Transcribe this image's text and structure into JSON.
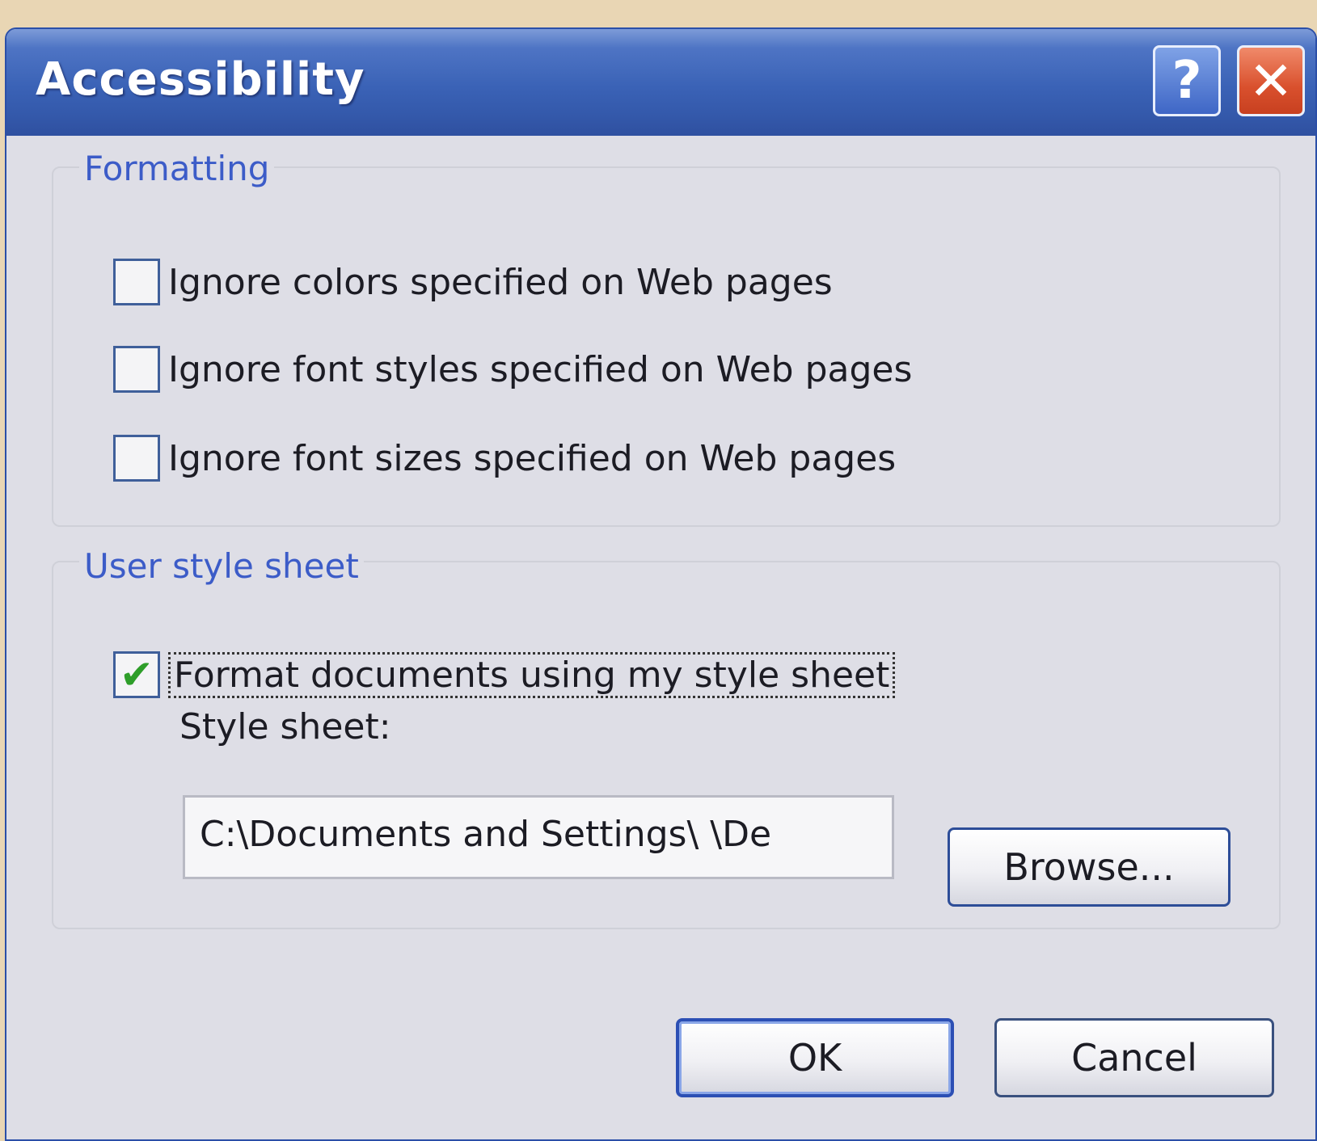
{
  "window": {
    "title": "Accessibility",
    "help_label": "?",
    "close_label": "✕"
  },
  "formatting": {
    "group_label": "Formatting",
    "options": [
      {
        "label": "Ignore colors specified on Web pages",
        "checked": false
      },
      {
        "label": "Ignore font styles specified on Web pages",
        "checked": false
      },
      {
        "label": "Ignore font sizes specified on Web pages",
        "checked": false
      }
    ]
  },
  "user_style_sheet": {
    "group_label": "User style sheet",
    "format_option": {
      "label": "Format documents using my style sheet",
      "checked": true,
      "check_mark": "✔"
    },
    "field_label": "Style sheet:",
    "path_value": "C:\\Documents and Settings\\ \\De",
    "browse_label": "Browse..."
  },
  "buttons": {
    "ok_label": "OK",
    "cancel_label": "Cancel"
  },
  "colors": {
    "titlebar": "#3a62b6",
    "group_label": "#3c5cc8",
    "close_button": "#d9502d",
    "check_mark": "#2e9e2a"
  }
}
